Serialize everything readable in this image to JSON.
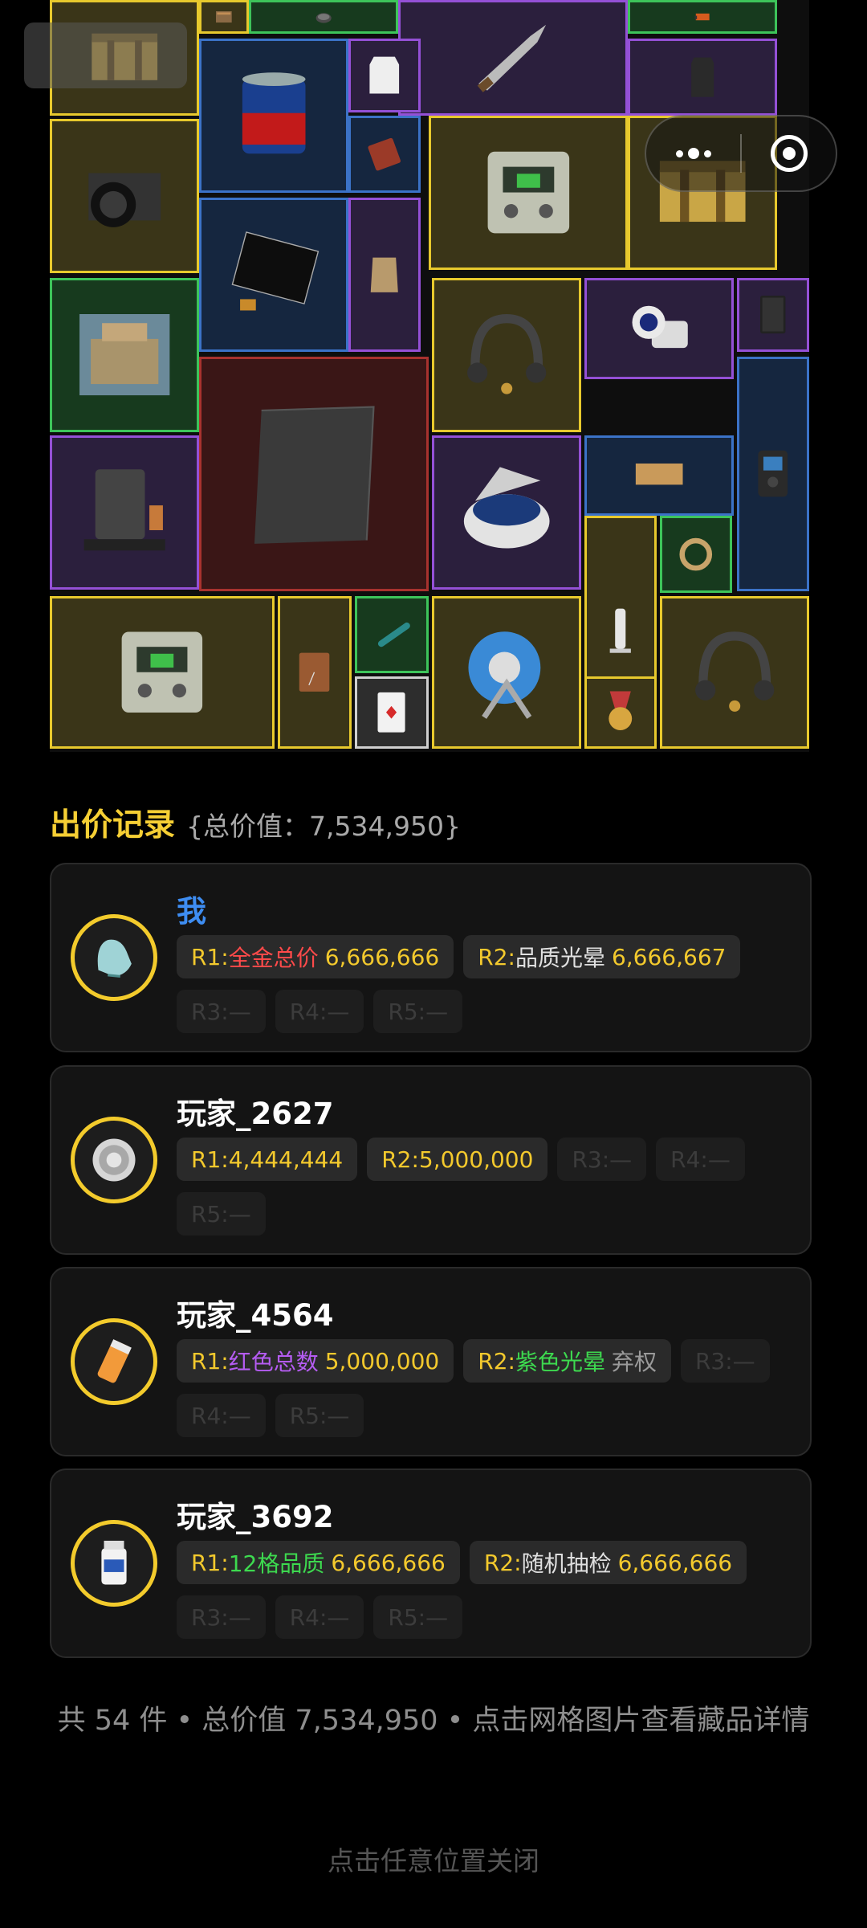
{
  "bid_section": {
    "title": "出价记录",
    "total_value": "{总价值：7,534,950}"
  },
  "bids": [
    {
      "name": "我",
      "is_me": true,
      "avatar_icon": "gloves-icon",
      "rounds": [
        {
          "round": "R1:",
          "label": "全金总价",
          "label_color": "#ff4a4a",
          "value": "6,666,666",
          "empty": false
        },
        {
          "round": "R2:",
          "label": "品质光晕",
          "label_color": "#e0e0e0",
          "value": "6,666,667",
          "empty": false
        },
        {
          "round": "R3:—",
          "empty": true
        },
        {
          "round": "R4:—",
          "empty": true
        },
        {
          "round": "R5:—",
          "empty": true
        }
      ]
    },
    {
      "name": "玩家_2627",
      "is_me": false,
      "avatar_icon": "coin-icon",
      "rounds": [
        {
          "round": "R1:",
          "value": "4,444,444",
          "empty": false
        },
        {
          "round": "R2:",
          "value": "5,000,000",
          "empty": false
        },
        {
          "round": "R3:—",
          "empty": true
        },
        {
          "round": "R4:—",
          "empty": true
        },
        {
          "round": "R5:—",
          "empty": true
        }
      ]
    },
    {
      "name": "玩家_4564",
      "is_me": false,
      "avatar_icon": "pill-bottle-icon",
      "rounds": [
        {
          "round": "R1:",
          "label": "红色总数",
          "label_color": "#b55cf2",
          "value": "5,000,000",
          "empty": false
        },
        {
          "round": "R2:",
          "label": "紫色光晕",
          "label_color": "#3dd94f",
          "value": "弃权",
          "value_grey": true,
          "empty": false
        },
        {
          "round": "R3:—",
          "empty": true
        },
        {
          "round": "R4:—",
          "empty": true
        },
        {
          "round": "R5:—",
          "empty": true
        }
      ]
    },
    {
      "name": "玩家_3692",
      "is_me": false,
      "avatar_icon": "medicine-bottle-icon",
      "rounds": [
        {
          "round": "R1:",
          "label": "12格品质",
          "label_color": "#3dd94f",
          "value": "6,666,666",
          "empty": false
        },
        {
          "round": "R2:",
          "label": "随机抽检",
          "label_color": "#e0e0e0",
          "value": "6,666,666",
          "empty": false
        },
        {
          "round": "R3:—",
          "empty": true
        },
        {
          "round": "R4:—",
          "empty": true
        },
        {
          "round": "R5:—",
          "empty": true
        }
      ]
    }
  ],
  "summary_text": "共 54 件 • 总价值 7,534,950 • 点击网格图片查看藏品详情",
  "close_hint": "点击任意位置关闭",
  "grid_items": [
    {
      "name": "supply-crate",
      "quality": "gold"
    },
    {
      "name": "tool-case",
      "quality": "gold"
    },
    {
      "name": "engine-part",
      "quality": "green"
    },
    {
      "name": "combat-knife",
      "quality": "purple"
    },
    {
      "name": "electric-saw",
      "quality": "green"
    },
    {
      "name": "paint-can",
      "quality": "blue"
    },
    {
      "name": "body-armor-plate",
      "quality": "purple"
    },
    {
      "name": "armor-insert",
      "quality": "purple"
    },
    {
      "name": "medium-format-camera",
      "quality": "gold"
    },
    {
      "name": "seasoning-packet",
      "quality": "blue"
    },
    {
      "name": "field-radio-station",
      "quality": "gold"
    },
    {
      "name": "supply-crate",
      "quality": "gold"
    },
    {
      "name": "display-panel",
      "quality": "blue"
    },
    {
      "name": "old-pouch",
      "quality": "purple"
    },
    {
      "name": "painting-villa",
      "quality": "green"
    },
    {
      "name": "carbon-fiber-sheet",
      "quality": "red"
    },
    {
      "name": "headset",
      "quality": "gold"
    },
    {
      "name": "blood-pressure-monitor",
      "quality": "purple"
    },
    {
      "name": "notebook",
      "quality": "purple"
    },
    {
      "name": "digital-recorder",
      "quality": "blue"
    },
    {
      "name": "coffee-machine",
      "quality": "purple"
    },
    {
      "name": "centrifuge",
      "quality": "purple"
    },
    {
      "name": "honeycomb-board",
      "quality": "blue"
    },
    {
      "name": "glass-tube",
      "quality": "gold"
    },
    {
      "name": "hose",
      "quality": "green"
    },
    {
      "name": "field-radio-station",
      "quality": "gold"
    },
    {
      "name": "leather-notebook",
      "quality": "gold"
    },
    {
      "name": "test-pen",
      "quality": "green"
    },
    {
      "name": "cable-reel",
      "quality": "gold"
    },
    {
      "name": "headset",
      "quality": "gold"
    },
    {
      "name": "playing-card",
      "quality": "white"
    },
    {
      "name": "medal",
      "quality": "gold"
    }
  ]
}
